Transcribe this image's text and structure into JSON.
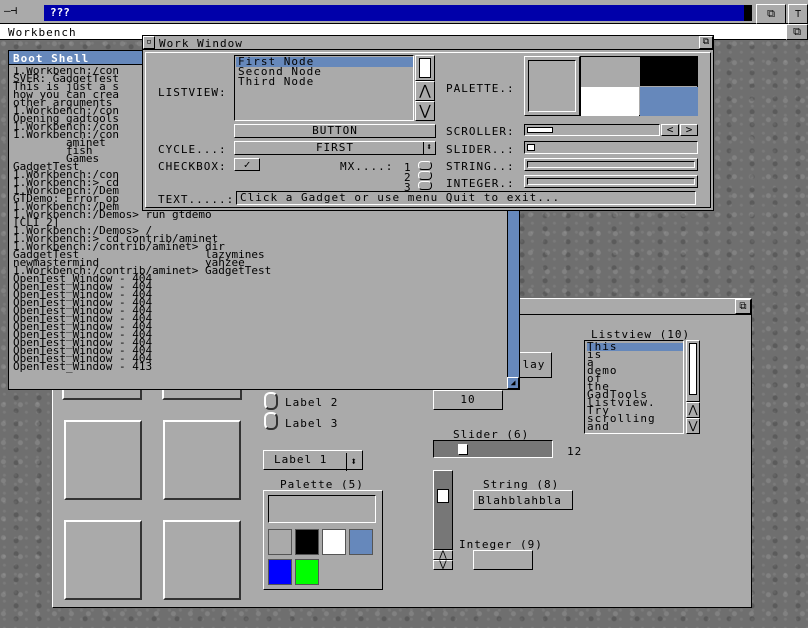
{
  "screen_title": "???",
  "workbench": {
    "title": "Workbench"
  },
  "shell": {
    "title": "Boot Shell",
    "lines": [
      "1.Workbench:/con",
      "SVER: GadgetTest",
      "This is just a s",
      "how you can crea",
      "other arguments ",
      "1.Workbench:/con",
      "Opening gadtools",
      "1.Workbench:/con",
      "1.Workbench:/con",
      "        aminet",
      "        fish",
      "        Games",
      "GadgetTest",
      "1.Workbench:/con",
      "1.Workbench:> cd",
      "1.Workbench:/Dem",
      "GTDemo: Error op",
      "1.Workbench:/Dem",
      "1.Workbench:/Demos> run gtdemo",
      "[CLI 2]",
      "1.Workbench:/Demos> /",
      "1.Workbench:> cd contrib/aminet",
      "1.Workbench:/contrib/aminet> dir",
      "GadgetTest                   lazymines",
      "newmastermind                yahzee",
      "1.Workbench:/contrib/aminet> GadgetTest",
      "OpenTest_Window - 404",
      "OpenTest_Window - 404",
      "OpenTest_Window - 404",
      "OpenTest_Window - 404",
      "OpenTest_Window - 404",
      "OpenTest_Window - 404",
      "OpenTest_Window - 404",
      "OpenTest_Window - 404",
      "OpenTest_Window - 404",
      "OpenTest_Window - 404",
      "OpenTest_Window - 404",
      "OpenTest_Window - 413"
    ]
  },
  "work": {
    "title": "Work Window",
    "listview_label": "LISTVIEW:",
    "nodes": [
      "First Node",
      "Second Node",
      "Third Node"
    ],
    "palette_label": "PALETTE.:",
    "button_label": "BUTTON",
    "scroller_label": "SCROLLER:",
    "cycle_label": "CYCLE...:",
    "cycle_value": "FIRST",
    "slider_label": "SLIDER..:",
    "checkbox_label": "CHECKBOX:",
    "mx_label": "MX....:",
    "mx_nums": [
      "1",
      "2",
      "3"
    ],
    "string_label": "STRING..:",
    "integer_label": "INTEGER.:",
    "text_label": "TEXT.....:",
    "text_value": "Click a Gadget or use menu Quit to exit...",
    "palette_colors": [
      "#aaaaaa",
      "#000000",
      "#ffffff",
      "#6688bb"
    ]
  },
  "demo": {
    "listview_title": "Listview (10)",
    "list_items": [
      "This",
      "is",
      "a",
      "demo",
      "of",
      "the",
      "GadTools",
      "listview.",
      "Try",
      "scrolling",
      "and"
    ],
    "button_partial": "lay",
    "number_value": "10",
    "label2": "Label 2",
    "label3": "Label 3",
    "slider_title": "Slider (6)",
    "slider_value": "12",
    "cycle_value": "Label 1",
    "palette_title": "Palette (5)",
    "palette_colors": [
      "#aaaaaa",
      "#000000",
      "#ffffff",
      "#6688bb",
      "#0000ff",
      "#00ff00"
    ],
    "string_title": "String (8)",
    "string_value": "Blahblahbla",
    "integer_title": "Integer (9)"
  },
  "colors": {
    "grey": "#aaaaaa",
    "blue": "#6688bb",
    "title_active": "#0000aa"
  }
}
